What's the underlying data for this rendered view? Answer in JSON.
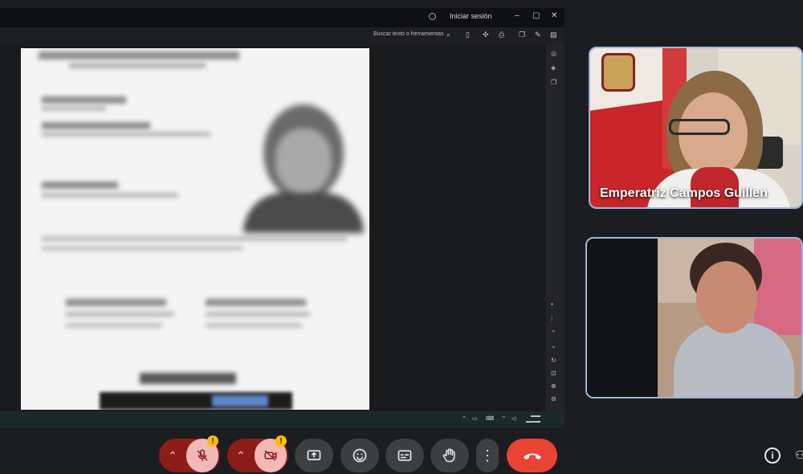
{
  "shared_screen": {
    "login_label": "Iniciar sesión",
    "search_label": "Buscar texto o herramientas",
    "footer_text": ""
  },
  "participants": [
    {
      "name": "Emperatriz Campos Guillen",
      "mic_muted": false
    },
    {
      "name": "",
      "mic_muted": false
    }
  ],
  "controls": {
    "mic": {
      "state": "muted",
      "warning": "!"
    },
    "camera": {
      "state": "off",
      "warning": "!"
    },
    "icons": [
      "chevron-up-icon",
      "mic-off-icon",
      "chevron-up-icon",
      "camera-off-icon",
      "present-icon",
      "emoji-icon",
      "captions-icon",
      "hand-icon",
      "more-icon",
      "end-call-icon",
      "info-icon",
      "people-icon"
    ]
  },
  "colors": {
    "background": "#1c1d21",
    "muted_red": "#8c1d18",
    "muted_inner": "#f2b8b5",
    "end_call": "#ea4335",
    "button_gray": "#3c4043",
    "tile_border": "#9fb6d8"
  }
}
